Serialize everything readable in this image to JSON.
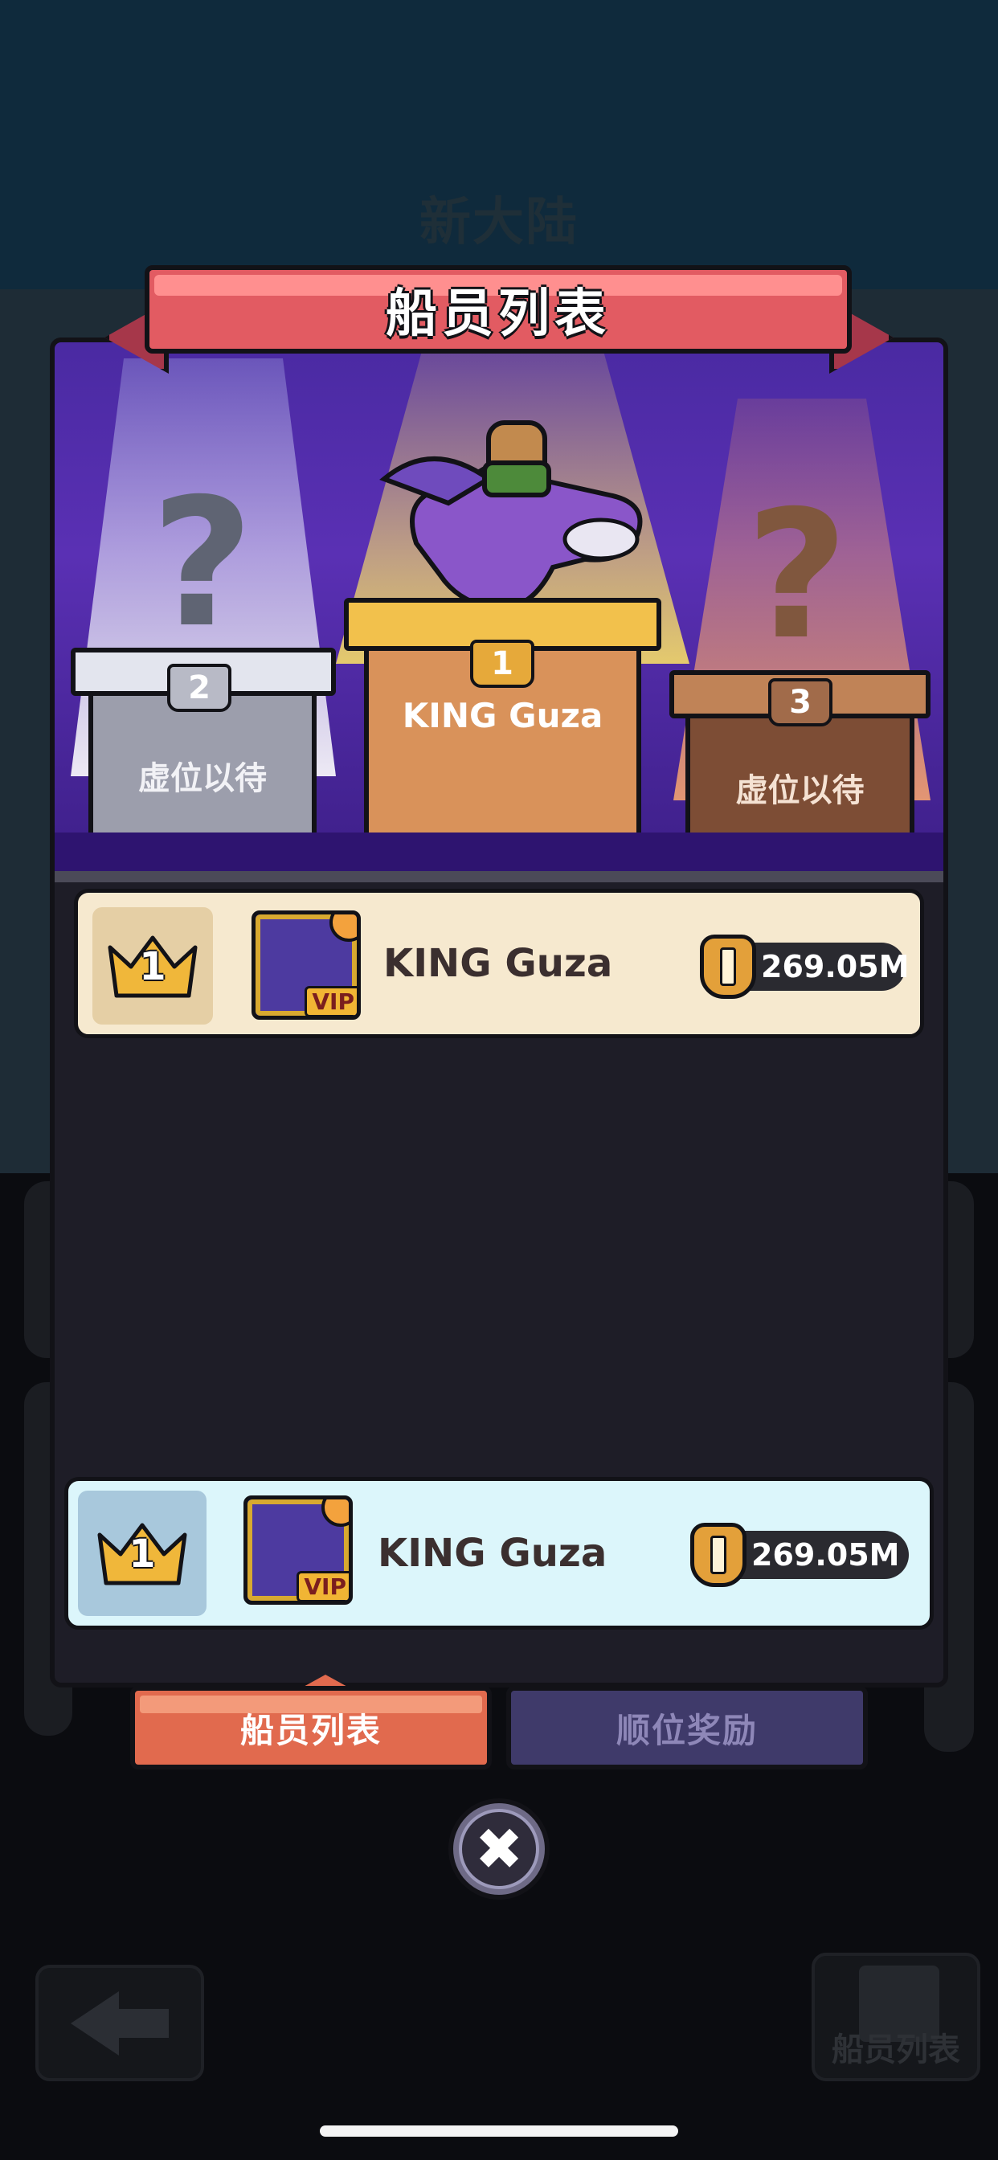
{
  "background": {
    "title": "新大陆",
    "crew_button_label": "船员列表"
  },
  "panel": {
    "title": "船员列表"
  },
  "podium": {
    "first": {
      "rank": "1",
      "name": "KING Guza"
    },
    "second": {
      "rank": "2",
      "name": "虚位以待",
      "placeholder_glyph": "?"
    },
    "third": {
      "rank": "3",
      "name": "虚位以待",
      "placeholder_glyph": "?"
    }
  },
  "ranking_list": [
    {
      "rank": "1",
      "name": "KING Guza",
      "power": "269.05M",
      "badge": "VIP"
    }
  ],
  "my_rank": {
    "rank": "1",
    "name": "KING Guza",
    "power": "269.05M",
    "badge": "VIP"
  },
  "tabs": [
    {
      "label": "船员列表",
      "active": true
    },
    {
      "label": "顺位奖励",
      "active": false
    }
  ],
  "close_button": {
    "glyph": "✖"
  },
  "colors": {
    "banner": "#e25b62",
    "stage": "#5a30b4",
    "tab_active": "#e16a4e",
    "tab_inactive": "#3f3a6a",
    "row_list_bg": "#f6e9cf",
    "row_me_bg": "#dcf6fb"
  },
  "icons": [
    "crown-icon",
    "sword-shield-icon",
    "close-icon",
    "question-mark-icon",
    "back-arrow-icon",
    "document-icon"
  ]
}
